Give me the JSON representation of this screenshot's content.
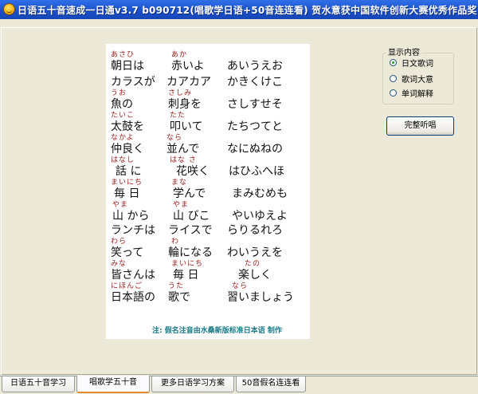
{
  "window": {
    "title": "日语五十音速成一日通v3.7 b090712(唱歌学日语+50音连连看) 贺水意获中国软件创新大赛优秀作品奖!"
  },
  "lyrics": {
    "lines": [
      {
        "furi": "あさひ",
        "kanji_furi": "あか",
        "jp": "朝日は",
        "jp2": "赤いよ",
        "kana": "あいうえお"
      },
      {
        "furi": "",
        "kanji_furi": "",
        "jp": "カラスが",
        "jp2": "カアカア",
        "kana": "かきくけこ"
      },
      {
        "furi": "うお",
        "kanji_furi": "さしみ",
        "jp": "魚の",
        "jp2": "刺身を",
        "kana": "さしすせそ"
      },
      {
        "furi": "たいこ",
        "kanji_furi": "たた",
        "jp": "太鼓を",
        "jp2": "叩いて",
        "kana": "たちつてと"
      },
      {
        "furi": "なかよ",
        "kanji_furi": "なら",
        "jp": "仲良く",
        "jp2": "並んで",
        "kana": "なにぬねの"
      },
      {
        "furi": "はなし",
        "kanji_furi": "はな さ",
        "jp": "話 に",
        "jp2": "花咲く",
        "kana": "はひふへほ"
      },
      {
        "furi": "まいにち",
        "kanji_furi": "まな",
        "jp": "毎 日",
        "jp2": "学んで",
        "kana": "まみむめも"
      },
      {
        "furi": "やま",
        "kanji_furi": "やま",
        "jp": "山 から",
        "jp2": "山 びこ",
        "kana": "やいゆえよ"
      },
      {
        "furi": "",
        "kanji_furi": "",
        "jp": "ランチは",
        "jp2": "ライスで",
        "kana": "らりるれろ"
      },
      {
        "furi": "わら",
        "kanji_furi": "わ",
        "jp": "笑って",
        "jp2": "輪になる",
        "kana": "わいうえを"
      },
      {
        "furi": "みな",
        "kanji_furi": "まいにち",
        "jp": "皆さんは",
        "jp2": "毎 日",
        "kana": "楽しく",
        "kana_furi": "たの"
      },
      {
        "furi": "にほんご",
        "kanji_furi": "うた",
        "jp": "日本語の",
        "jp2": "歌で",
        "kana": "習いましょう",
        "kana_furi": "なら"
      }
    ],
    "note": "注: 假名注音由水桑新版标准日本语 制作"
  },
  "options": {
    "title": "显示内容",
    "radios": [
      {
        "label": "日文歌词",
        "checked": true
      },
      {
        "label": "歌词大意",
        "checked": false
      },
      {
        "label": "单词解释",
        "checked": false
      }
    ],
    "button_label": "完整听唱"
  },
  "tabs": [
    {
      "label": "日语五十音学习",
      "active": false
    },
    {
      "label": "唱歌学五十音",
      "active": true
    },
    {
      "label": "更多日语学习方案",
      "active": false
    },
    {
      "label": "50音假名连连看",
      "active": false
    }
  ],
  "colors": {
    "furigana": "#9b1a1a",
    "note": "#1b7a8a",
    "titlebar": "#1a4fc7"
  }
}
